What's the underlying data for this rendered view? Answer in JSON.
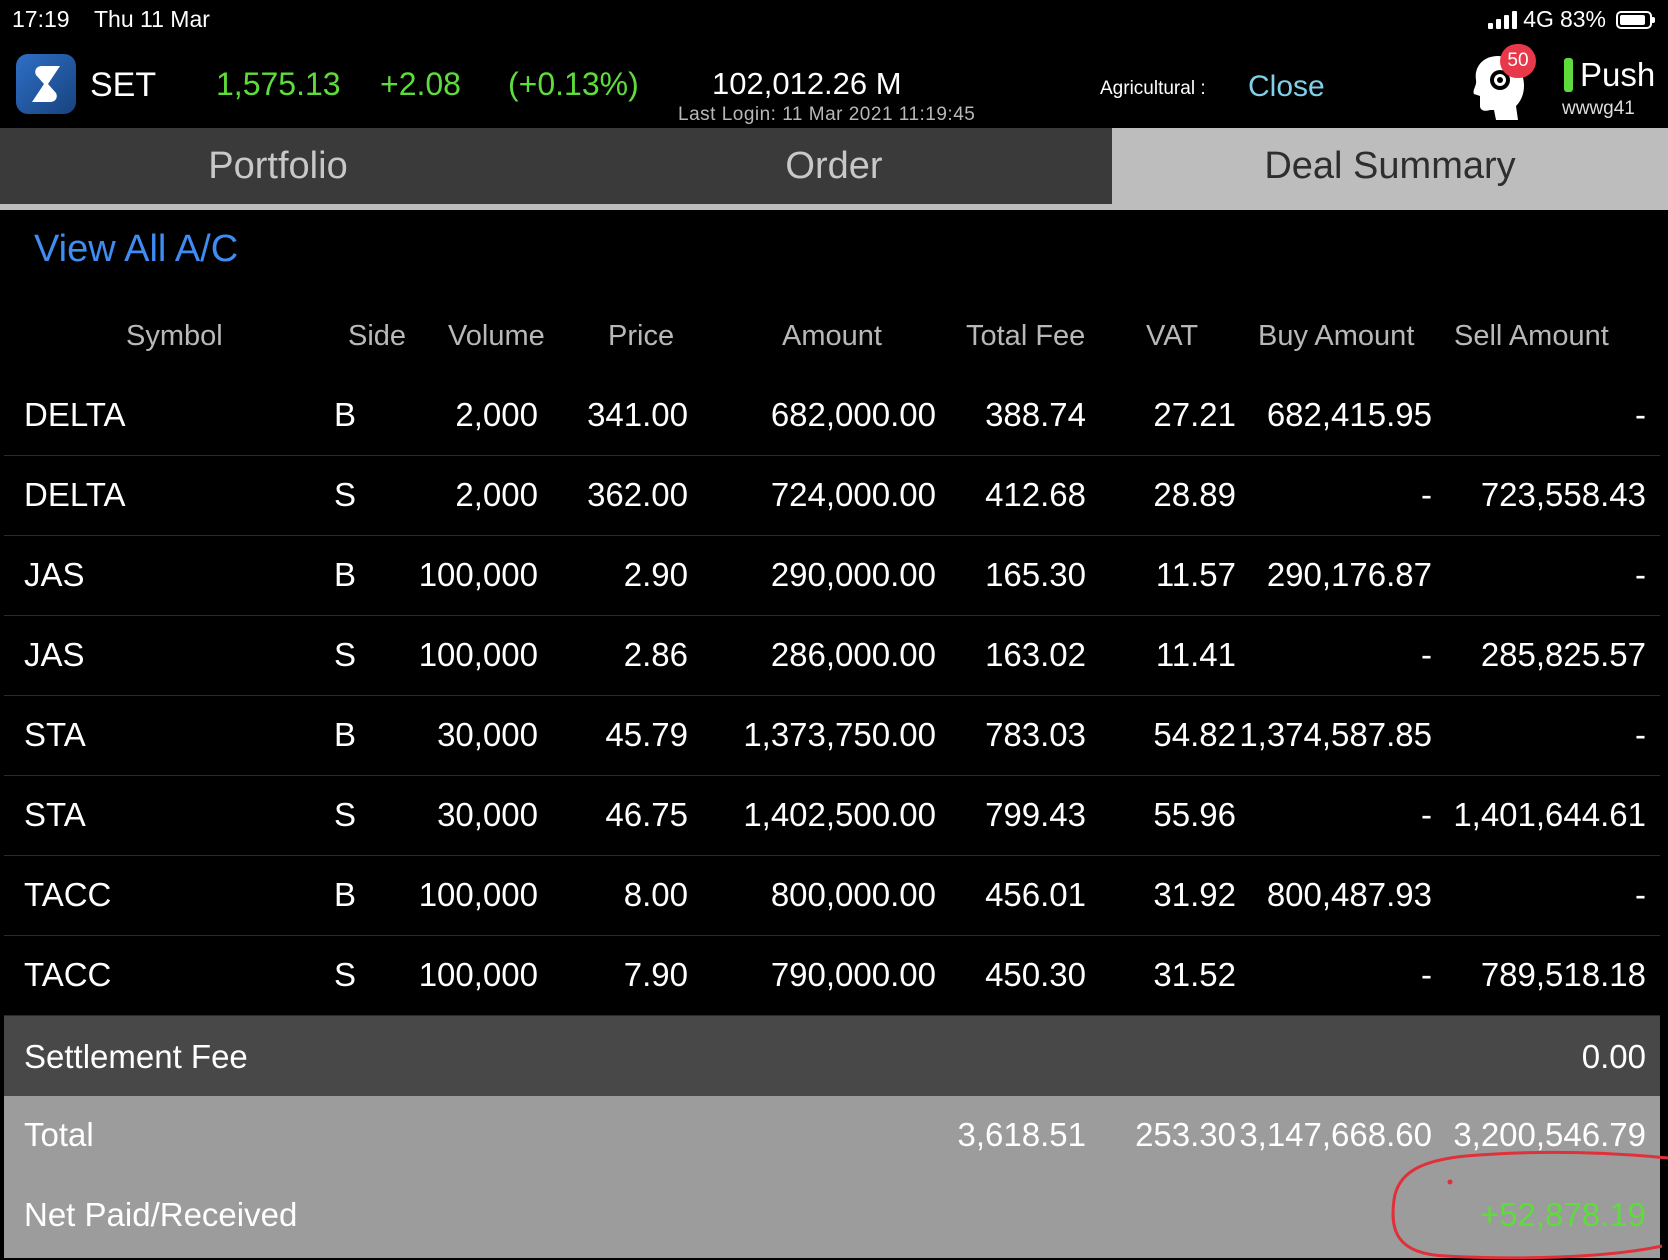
{
  "status_bar": {
    "time": "17:19",
    "date": "Thu 11 Mar",
    "network": "4G",
    "battery": "83%",
    "battery_level": 0.83
  },
  "header": {
    "index_name": "SET",
    "index_value": "1,575.13",
    "index_change": "+2.08",
    "index_change_pct": "(+0.13%)",
    "volume": "102,012.26 M",
    "last_login": "Last Login: 11 Mar 2021 11:19:45",
    "sector_label": "Agricultural :",
    "sector_status": "Close",
    "notification_count": "50",
    "push_label": "Push",
    "username": "wwwg41",
    "accent_green": "#5edc3c",
    "accent_blue": "#3f8cf3"
  },
  "tabs": [
    {
      "label": "Portfolio",
      "active": false
    },
    {
      "label": "Order",
      "active": false
    },
    {
      "label": "Deal Summary",
      "active": true
    }
  ],
  "view_all_label": "View All A/C",
  "table": {
    "columns": [
      "Symbol",
      "Side",
      "Volume",
      "Price",
      "Amount",
      "Total Fee",
      "VAT",
      "Buy Amount",
      "Sell Amount"
    ],
    "rows": [
      {
        "symbol": "DELTA",
        "side": "B",
        "volume": "2,000",
        "price": "341.00",
        "amount": "682,000.00",
        "fee": "388.74",
        "vat": "27.21",
        "buy": "682,415.95",
        "sell": "-"
      },
      {
        "symbol": "DELTA",
        "side": "S",
        "volume": "2,000",
        "price": "362.00",
        "amount": "724,000.00",
        "fee": "412.68",
        "vat": "28.89",
        "buy": "-",
        "sell": "723,558.43"
      },
      {
        "symbol": "JAS",
        "side": "B",
        "volume": "100,000",
        "price": "2.90",
        "amount": "290,000.00",
        "fee": "165.30",
        "vat": "11.57",
        "buy": "290,176.87",
        "sell": "-"
      },
      {
        "symbol": "JAS",
        "side": "S",
        "volume": "100,000",
        "price": "2.86",
        "amount": "286,000.00",
        "fee": "163.02",
        "vat": "11.41",
        "buy": "-",
        "sell": "285,825.57"
      },
      {
        "symbol": "STA",
        "side": "B",
        "volume": "30,000",
        "price": "45.79",
        "amount": "1,373,750.00",
        "fee": "783.03",
        "vat": "54.82",
        "buy": "1,374,587.85",
        "sell": "-"
      },
      {
        "symbol": "STA",
        "side": "S",
        "volume": "30,000",
        "price": "46.75",
        "amount": "1,402,500.00",
        "fee": "799.43",
        "vat": "55.96",
        "buy": "-",
        "sell": "1,401,644.61"
      },
      {
        "symbol": "TACC",
        "side": "B",
        "volume": "100,000",
        "price": "8.00",
        "amount": "800,000.00",
        "fee": "456.01",
        "vat": "31.92",
        "buy": "800,487.93",
        "sell": "-"
      },
      {
        "symbol": "TACC",
        "side": "S",
        "volume": "100,000",
        "price": "7.90",
        "amount": "790,000.00",
        "fee": "450.30",
        "vat": "31.52",
        "buy": "-",
        "sell": "789,518.18"
      }
    ]
  },
  "settlement": {
    "label": "Settlement Fee",
    "value": "0.00"
  },
  "totals": {
    "label": "Total",
    "fee": "3,618.51",
    "vat": "253.30",
    "buy": "3,147,668.60",
    "sell": "3,200,546.79",
    "net_label": "Net Paid/Received",
    "net_value": "+52,878.19"
  },
  "annotation_color": "#e0303a"
}
